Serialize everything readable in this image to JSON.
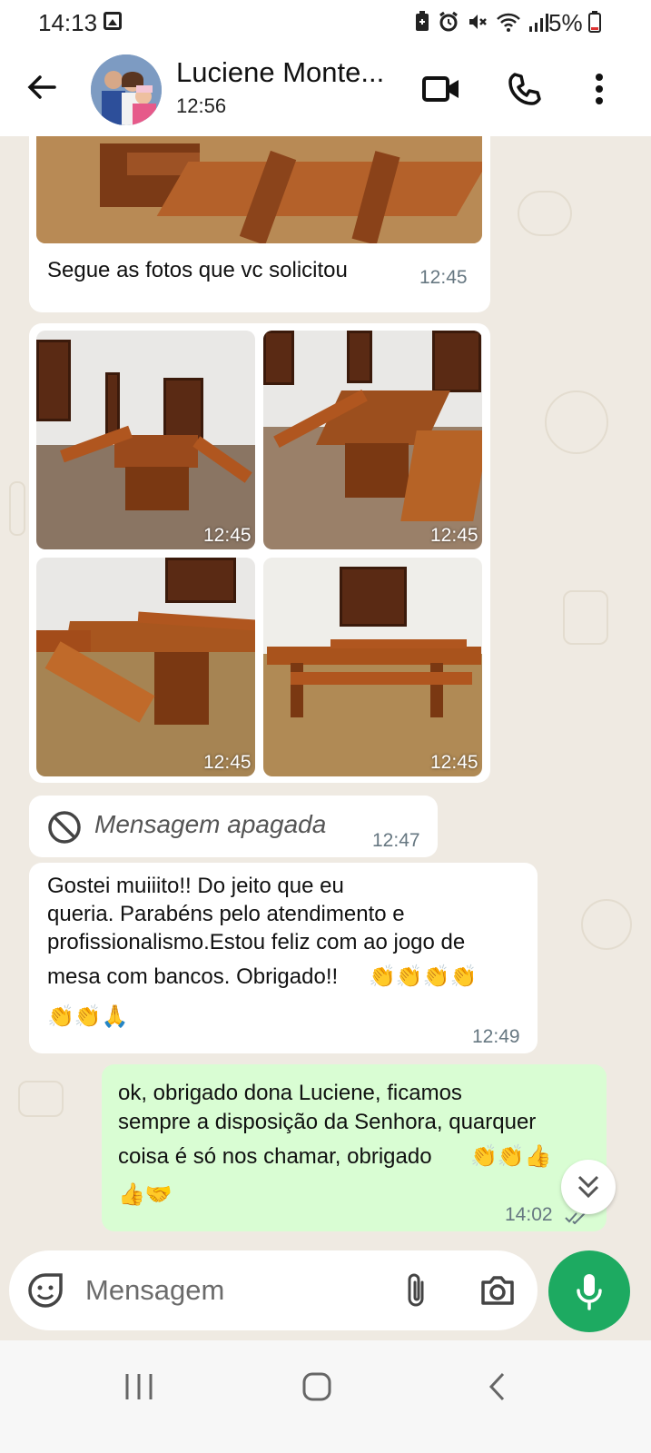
{
  "status_bar": {
    "time": "14:13",
    "battery_percent": "5%",
    "icons": [
      "image-icon",
      "battery-saver-icon",
      "alarm-icon",
      "mute-icon",
      "wifi-icon",
      "signal-icon",
      "battery-icon"
    ]
  },
  "header": {
    "contact_name": "Luciene Monte...",
    "last_seen": "12:56",
    "icons": [
      "back-arrow-icon",
      "video-call-icon",
      "phone-call-icon",
      "more-options-icon"
    ]
  },
  "messages": {
    "caption_text": "Segue as fotos que vc solicitou",
    "caption_time": "12:45",
    "photo_times": [
      "12:45",
      "12:45",
      "12:45",
      "12:45"
    ],
    "deleted_text": "Mensagem apagada",
    "deleted_time": "12:47",
    "incoming_lines": [
      "Gostei muiiito!! Do jeito que eu",
      "queria. Parabéns pelo atendimento e",
      "profissionalismo.Estou feliz com ao jogo de",
      "mesa com bancos. Obrigado!!"
    ],
    "incoming_emoji_1": "👏👏👏👏",
    "incoming_emoji_2": "👏👏🙏",
    "incoming_time": "12:49",
    "outgoing_lines": [
      "ok, obrigado dona Luciene,  ficamos",
      "sempre a disposição da Senhora, quarquer",
      "coisa é só nos chamar, obrigado"
    ],
    "outgoing_emoji_1": "👏👏👍",
    "outgoing_emoji_2": "👍🤝",
    "outgoing_time": "14:02"
  },
  "input": {
    "placeholder": "Mensagem",
    "icons": [
      "sticker-icon",
      "attach-icon",
      "camera-icon",
      "mic-icon"
    ]
  },
  "colors": {
    "accent_green": "#1daa61",
    "outgoing_bubble": "#d9fdd3",
    "chat_background": "#efeae2"
  }
}
